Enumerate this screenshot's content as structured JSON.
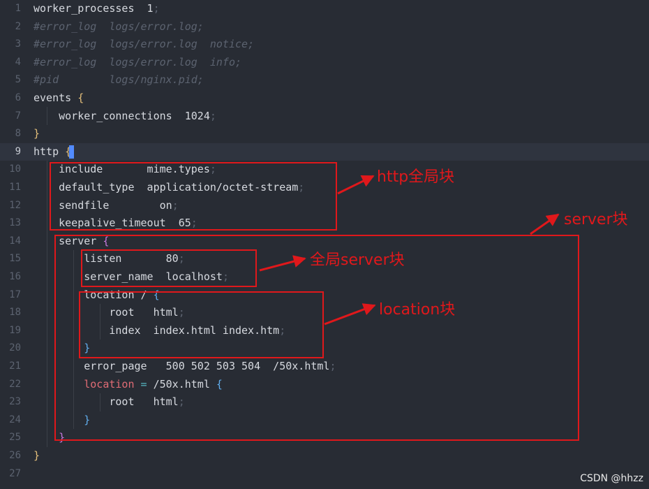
{
  "lines": [
    {
      "n": "1",
      "tokens": [
        {
          "t": "worker_processes  1",
          "c": ""
        },
        {
          "t": ";",
          "c": "pt"
        }
      ]
    },
    {
      "n": "2",
      "tokens": [
        {
          "t": "#error_log  logs/error.log;",
          "c": "cm"
        }
      ]
    },
    {
      "n": "3",
      "tokens": [
        {
          "t": "#error_log  logs/error.log  notice;",
          "c": "cm"
        }
      ]
    },
    {
      "n": "4",
      "tokens": [
        {
          "t": "#error_log  logs/error.log  info;",
          "c": "cm"
        }
      ]
    },
    {
      "n": "5",
      "tokens": [
        {
          "t": "#pid        logs/nginx.pid;",
          "c": "cm"
        }
      ]
    },
    {
      "n": "6",
      "tokens": [
        {
          "t": "events ",
          "c": ""
        },
        {
          "t": "{",
          "c": "yb"
        }
      ]
    },
    {
      "n": "7",
      "tokens": [
        {
          "t": "    worker_connections  1024",
          "c": ""
        },
        {
          "t": ";",
          "c": "pt"
        }
      ]
    },
    {
      "n": "8",
      "tokens": [
        {
          "t": "}",
          "c": "yb"
        }
      ]
    },
    {
      "n": "9",
      "tokens": [
        {
          "t": "http ",
          "c": ""
        },
        {
          "t": "{",
          "c": "yb"
        }
      ],
      "current": true,
      "cursor": true
    },
    {
      "n": "10",
      "tokens": [
        {
          "t": "    include       mime.types",
          "c": ""
        },
        {
          "t": ";",
          "c": "pt"
        }
      ]
    },
    {
      "n": "11",
      "tokens": [
        {
          "t": "    default_type  application/octet-stream",
          "c": ""
        },
        {
          "t": ";",
          "c": "pt"
        }
      ]
    },
    {
      "n": "12",
      "tokens": [
        {
          "t": "    sendfile        on",
          "c": ""
        },
        {
          "t": ";",
          "c": "pt"
        }
      ]
    },
    {
      "n": "13",
      "tokens": [
        {
          "t": "    keepalive_timeout  65",
          "c": ""
        },
        {
          "t": ";",
          "c": "pt"
        }
      ]
    },
    {
      "n": "14",
      "tokens": [
        {
          "t": "    server ",
          "c": ""
        },
        {
          "t": "{",
          "c": "pb"
        }
      ]
    },
    {
      "n": "15",
      "tokens": [
        {
          "t": "        listen       80",
          "c": ""
        },
        {
          "t": ";",
          "c": "pt"
        }
      ]
    },
    {
      "n": "16",
      "tokens": [
        {
          "t": "        server_name  localhost",
          "c": ""
        },
        {
          "t": ";",
          "c": "pt"
        }
      ]
    },
    {
      "n": "17",
      "tokens": [
        {
          "t": "        location / ",
          "c": ""
        },
        {
          "t": "{",
          "c": "bb"
        }
      ]
    },
    {
      "n": "18",
      "tokens": [
        {
          "t": "            root   html",
          "c": ""
        },
        {
          "t": ";",
          "c": "pt"
        }
      ]
    },
    {
      "n": "19",
      "tokens": [
        {
          "t": "            index  index.html index.htm",
          "c": ""
        },
        {
          "t": ";",
          "c": "pt"
        }
      ]
    },
    {
      "n": "20",
      "tokens": [
        {
          "t": "        ",
          "c": ""
        },
        {
          "t": "}",
          "c": "bb"
        }
      ]
    },
    {
      "n": "21",
      "tokens": [
        {
          "t": "        error_page   500 502 503 504  /50x.html",
          "c": ""
        },
        {
          "t": ";",
          "c": "pt"
        }
      ]
    },
    {
      "n": "22",
      "tokens": [
        {
          "t": "        ",
          "c": ""
        },
        {
          "t": "location",
          "c": "kw"
        },
        {
          "t": " ",
          "c": ""
        },
        {
          "t": "=",
          "c": "eq"
        },
        {
          "t": " /50x.html ",
          "c": ""
        },
        {
          "t": "{",
          "c": "bb"
        }
      ]
    },
    {
      "n": "23",
      "tokens": [
        {
          "t": "            root   html",
          "c": ""
        },
        {
          "t": ";",
          "c": "pt"
        }
      ]
    },
    {
      "n": "24",
      "tokens": [
        {
          "t": "        ",
          "c": ""
        },
        {
          "t": "}",
          "c": "bb"
        }
      ]
    },
    {
      "n": "25",
      "tokens": [
        {
          "t": "    ",
          "c": ""
        },
        {
          "t": "}",
          "c": "pb"
        }
      ]
    },
    {
      "n": "26",
      "tokens": [
        {
          "t": "}",
          "c": "yb"
        }
      ]
    },
    {
      "n": "27",
      "tokens": []
    }
  ],
  "annotations": {
    "http_global": "http全局块",
    "server": "server块",
    "server_global": "全局server块",
    "location": "location块"
  },
  "watermark": "CSDN @hhzz",
  "colors": {
    "background": "#282c34",
    "annotation_red": "#e0181b",
    "line_number": "#5c6370",
    "text": "#d7dae0",
    "comment": "#5c6370",
    "brace_level1": "#e5c07b",
    "brace_level2": "#c678dd",
    "brace_level3": "#61afef",
    "keyword": "#e06c75",
    "operator": "#56b6c2",
    "cursor": "#528bff"
  }
}
